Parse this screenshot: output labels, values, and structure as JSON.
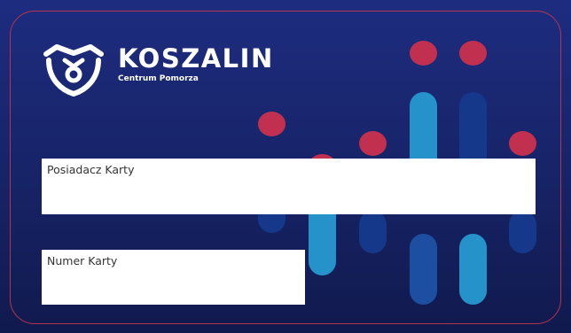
{
  "brand": {
    "name": "KOSZALIN",
    "tagline": "Centrum Pomorza"
  },
  "fields": {
    "holder_label": "Posiadacz Karty",
    "number_label": "Numer Karty"
  },
  "colors": {
    "background": "#1a2773",
    "accent_red": "#c1304f",
    "bar_light_blue": "#2592c9",
    "bar_mid_blue": "#1c4fa2",
    "bar_dark_blue": "#15388a",
    "field_background": "#ffffff"
  },
  "icons": {
    "logo": "koszalin-crest-icon"
  }
}
